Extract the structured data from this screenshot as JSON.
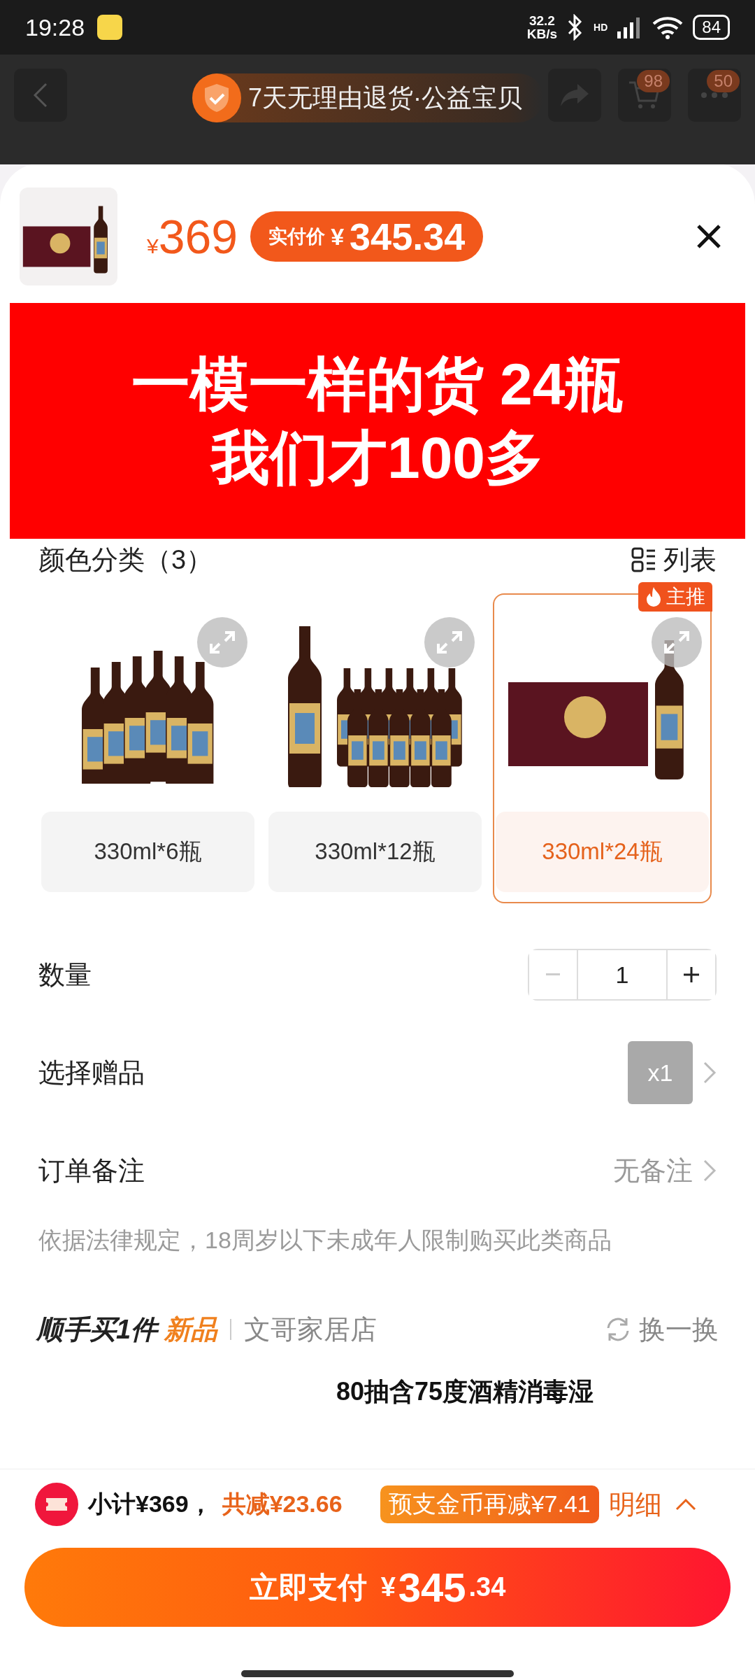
{
  "status_bar": {
    "time": "19:28",
    "net_speed": "32.2",
    "net_unit": "KB/s",
    "network_label": "HD",
    "battery": "84"
  },
  "top_bar": {
    "guarantee_badge": "7天无理由退货·公益宝贝",
    "cart_count": "98",
    "message_count": "50"
  },
  "sheet_header": {
    "price_symbol": "¥",
    "price": "369",
    "paid_label": "实付价",
    "paid_symbol": "¥",
    "paid_amount": "345.34"
  },
  "overlay_banner": {
    "lines": [
      "一模一样的货 24瓶",
      "我们才100多"
    ]
  },
  "variants": {
    "title": "颜色分类（3）",
    "view_toggle": "列表",
    "options": [
      {
        "label": "330ml*6瓶",
        "selected": false,
        "kind": "six"
      },
      {
        "label": "330ml*12瓶",
        "selected": false,
        "kind": "twelve"
      },
      {
        "label": "330ml*24瓶",
        "selected": true,
        "kind": "case",
        "tag": "主推"
      }
    ]
  },
  "quantity": {
    "label": "数量",
    "value": "1",
    "decrement_disabled": true
  },
  "gift": {
    "label": "选择赠品",
    "count": "x1"
  },
  "order_note": {
    "label": "订单备注",
    "value": "无备注"
  },
  "legal_notice": "依据法律规定，18周岁以下未成年人限制购买此类商品",
  "addon": {
    "title": "顺手买1件",
    "tag": "新品",
    "shop": "文哥家居店",
    "refresh": "换一换",
    "product_title": "80抽含75度酒精消毒湿"
  },
  "footer": {
    "subtotal": "小计¥369，",
    "discount": "共减¥23.66",
    "coin_offer": "预支金币再减¥7.41",
    "details": "明细",
    "pay_label": "立即支付",
    "pay_symbol": "¥",
    "pay_integer": "345",
    "pay_decimal": ".34"
  }
}
